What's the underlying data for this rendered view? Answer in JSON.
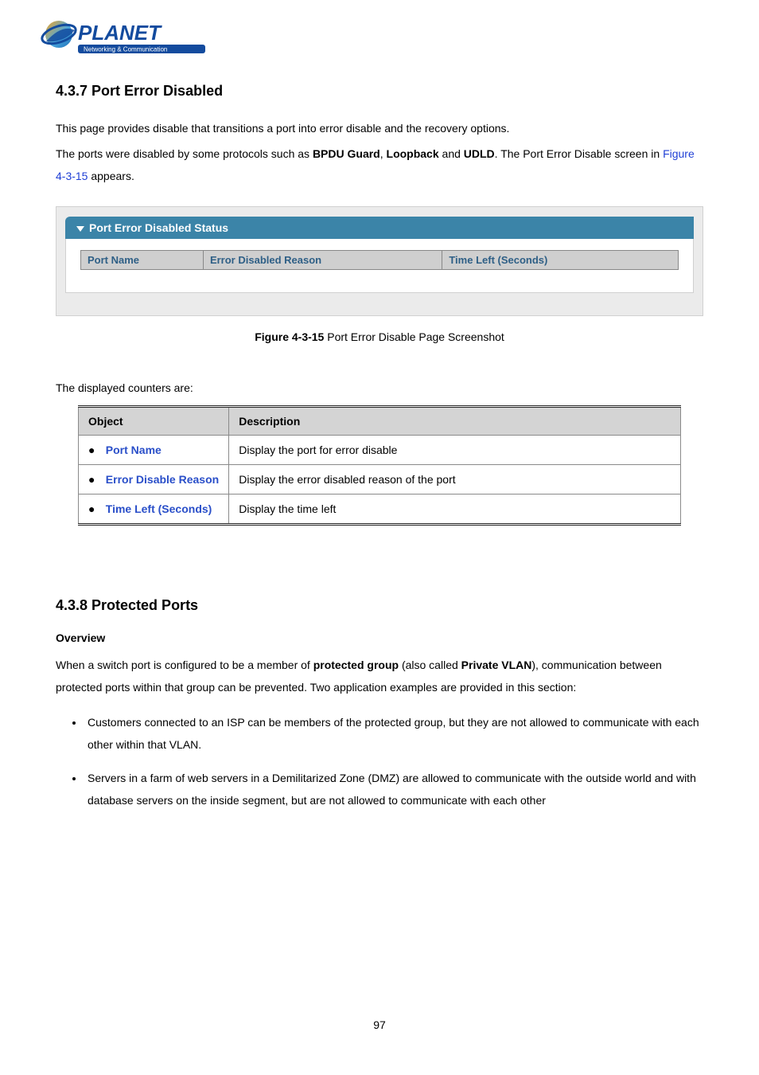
{
  "logo": {
    "brand": "PLANET",
    "tagline": "Networking & Communication"
  },
  "section437": {
    "heading": "4.3.7 Port Error Disabled",
    "line1": "This page provides disable that transitions a port into error disable and the recovery options.",
    "line2_pre": "The ports were disabled by some protocols such as ",
    "line2_b1": "BPDU Guard",
    "line2_sep": ", ",
    "line2_b2": "Loopback",
    "line2_and": " and ",
    "line2_b3": "UDLD",
    "line2_post": ". The Port Error Disable screen in ",
    "line2_link": "Figure 4-3-15",
    "line2_tail": " appears."
  },
  "panel": {
    "title": "Port Error Disabled Status",
    "cols": [
      "Port Name",
      "Error Disabled Reason",
      "Time Left (Seconds)"
    ]
  },
  "figureCaption": {
    "bold": "Figure 4-3-15",
    "rest": " Port Error Disable Page Screenshot"
  },
  "countersIntro": "The displayed counters are:",
  "objTable": {
    "head": [
      "Object",
      "Description"
    ],
    "rows": [
      {
        "term": "Port Name",
        "desc": "Display the port for error disable"
      },
      {
        "term": "Error Disable Reason",
        "desc": "Display the error disabled reason of the port"
      },
      {
        "term": "Time Left (Seconds)",
        "desc": "Display the time left"
      }
    ]
  },
  "section438": {
    "heading": "4.3.8 Protected Ports",
    "overview": "Overview",
    "para_pre": "When a switch port is configured to be a member of ",
    "para_b1": "protected group",
    "para_mid": " (also called ",
    "para_b2": "Private VLAN",
    "para_post": "), communication between protected ports within that group can be prevented. Two application examples are provided in this section:",
    "bullets": [
      "Customers connected to an ISP can be members of the protected group, but they are not allowed to communicate with each other within that VLAN.",
      "Servers in a farm of web servers in a Demilitarized Zone (DMZ) are allowed to communicate with the outside world and with database servers on the inside segment, but are not allowed to communicate with each other"
    ]
  },
  "pageNumber": "97"
}
